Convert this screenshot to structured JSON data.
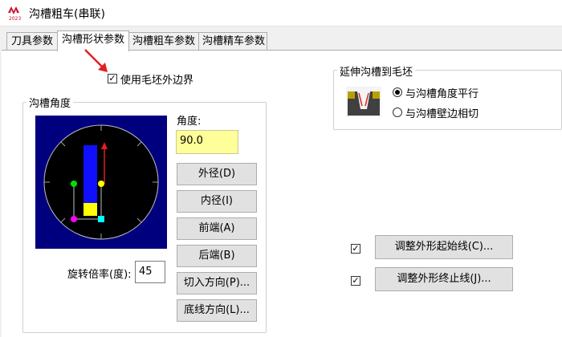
{
  "window": {
    "title": "沟槽粗车(串联)"
  },
  "tabs": [
    {
      "label": "刀具参数",
      "active": false
    },
    {
      "label": "沟槽形状参数",
      "active": true
    },
    {
      "label": "沟槽粗车参数",
      "active": false
    },
    {
      "label": "沟槽精车参数",
      "active": false
    }
  ],
  "use_stock_boundary": {
    "label": "使用毛坯外边界",
    "checked": true
  },
  "groove_angle": {
    "title": "沟槽角度",
    "angle_label": "角度:",
    "angle_value": "90.0",
    "buttons": {
      "od": "外径(D)",
      "id": "内径(I)",
      "front": "前端(A)",
      "back": "后端(B)",
      "plunge_direction": "切入方向(P)...",
      "floor_direction": "底线方向(L)..."
    },
    "rotation_label": "旋转倍率(度):",
    "rotation_value": "45"
  },
  "extend_to_stock": {
    "title": "延伸沟槽到毛坯",
    "options": [
      {
        "label": "与沟槽角度平行",
        "selected": true
      },
      {
        "label": "与沟槽壁边相切",
        "selected": false
      }
    ]
  },
  "adjust_start": {
    "label": "调整外形起始线(C)...",
    "checked": true
  },
  "adjust_end": {
    "label": "调整外形终止线(J)...",
    "checked": true
  },
  "app_icon_label": "2023",
  "colors": {
    "preview_bg": "#00007f",
    "accent_red": "#e02020",
    "input_yellow": "#ffff99"
  }
}
